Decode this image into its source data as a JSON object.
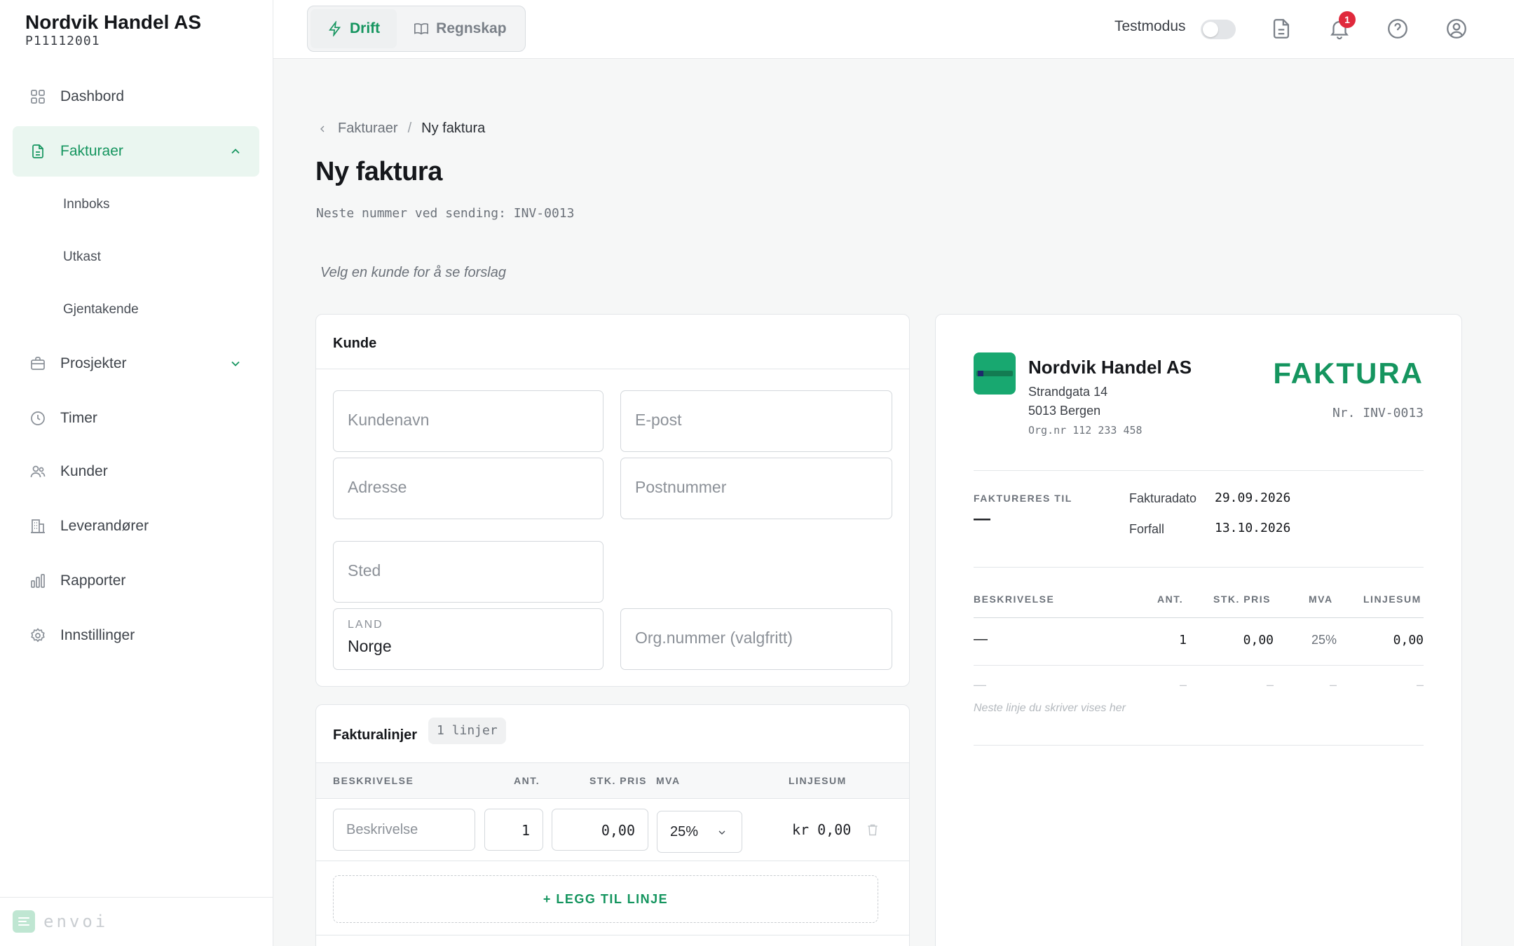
{
  "sidebar": {
    "org_name": "Nordvik Handel AS",
    "org_id": "P11112001",
    "items": [
      {
        "label": "Dashbord"
      },
      {
        "label": "Fakturaer"
      },
      {
        "label": "Prosjekter"
      },
      {
        "label": "Timer"
      },
      {
        "label": "Kunder"
      },
      {
        "label": "Leverandører"
      },
      {
        "label": "Rapporter"
      },
      {
        "label": "Innstillinger"
      }
    ],
    "sub_items": [
      {
        "label": "Innboks"
      },
      {
        "label": "Utkast"
      },
      {
        "label": "Gjentakende"
      }
    ],
    "footer_brand": "envoi"
  },
  "topbar": {
    "modes": [
      {
        "label": "Drift",
        "active": true
      },
      {
        "label": "Regnskap",
        "active": false
      }
    ],
    "testmode_label": "Testmodus",
    "notification_count": "1"
  },
  "breadcrumb": {
    "parent": "Fakturaer",
    "separator": "/",
    "current": "Ny faktura"
  },
  "page": {
    "title": "Ny faktura",
    "next_number": "Neste nummer ved sending: INV-0013",
    "hint": "Velg en kunde for å se forslag"
  },
  "customer_card": {
    "title": "Kunde",
    "fields": {
      "name": "Kundenavn",
      "email": "E-post",
      "address": "Adresse",
      "postal": "Postnummer",
      "city": "Sted",
      "country_label": "LAND",
      "country_value": "Norge",
      "org": "Org.nummer (valgfritt)"
    }
  },
  "lines_card": {
    "title": "Fakturalinjer",
    "count": "1 linjer",
    "headers": {
      "desc": "BESKRIVELSE",
      "qty": "ANT.",
      "price": "STK. PRIS",
      "vat": "MVA",
      "sum": "LINJESUM"
    },
    "row": {
      "desc_placeholder": "Beskrivelse",
      "qty": "1",
      "price": "0,00",
      "vat": "25%",
      "sum": "kr 0,00"
    },
    "add_label": "+ LEGG TIL LINJE"
  },
  "invoice": {
    "company": "Nordvik Handel AS",
    "street": "Strandgata 14",
    "city": "5013 Bergen",
    "org": "Org.nr 112 233 458",
    "heading": "FAKTURA",
    "number": "Nr. INV-0013",
    "bill_to_label": "FAKTURERES TIL",
    "bill_to_value": "—",
    "date_label": "Fakturadato",
    "date_value": "29.09.2026",
    "due_label": "Forfall",
    "due_value": "13.10.2026",
    "headers": {
      "desc": "BESKRIVELSE",
      "qty": "ANT.",
      "price": "STK. PRIS",
      "vat": "MVA",
      "sum": "LINJESUM"
    },
    "row": {
      "desc": "—",
      "qty": "1",
      "price": "0,00",
      "vat": "25%",
      "sum": "0,00"
    },
    "ghost_row": {
      "desc": "—",
      "qty": "–",
      "price": "–",
      "vat": "–",
      "sum": "–",
      "note": "Neste linje du skriver vises her"
    }
  },
  "colors": {
    "accent": "#15955f",
    "badge": "#e0293c"
  }
}
